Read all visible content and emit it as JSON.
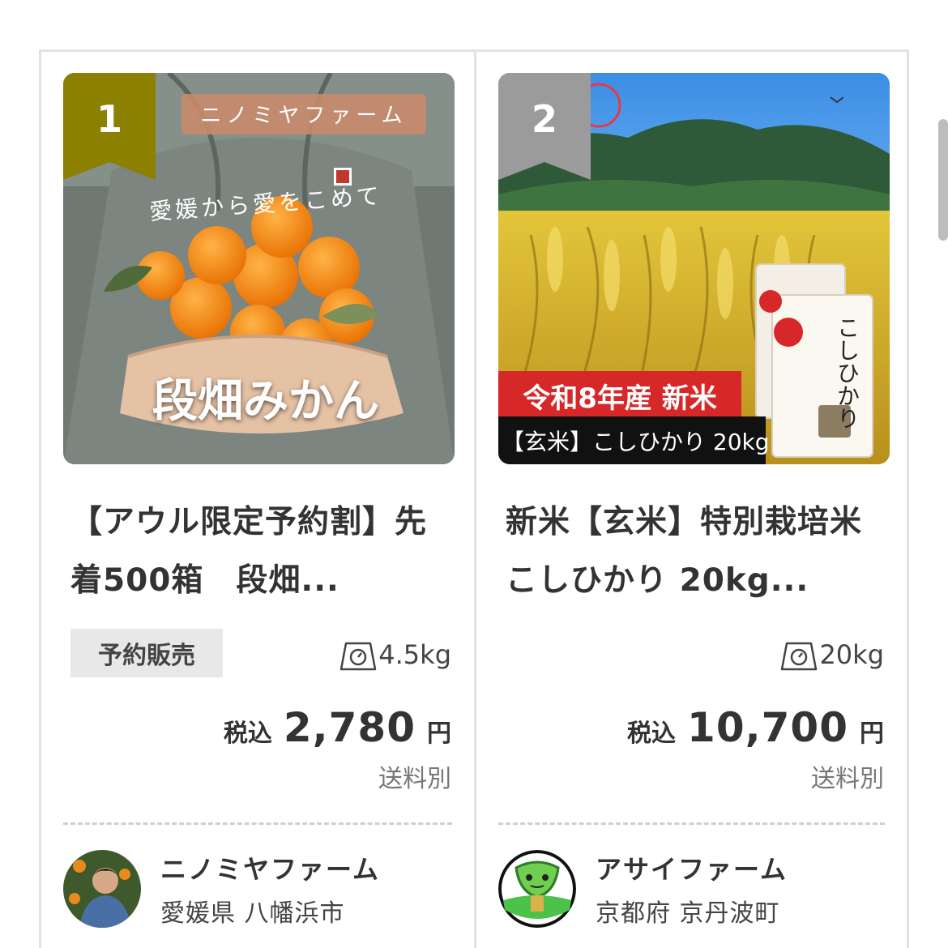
{
  "products": [
    {
      "rank": "1",
      "image_text": {
        "farm_banner": "ニノミヤファーム",
        "tagline": "愛媛から愛をこめて",
        "main_label": "段畑みかん"
      },
      "title": "【アウル限定予約割】先着500箱　段畑みかん",
      "title_display": "【アウル限定予約割】先着500箱　段畑...",
      "badge": "予約販売",
      "weight": "4.5kg",
      "tax_label": "税込",
      "price": "2,780",
      "currency": "円",
      "shipping": "送料別",
      "seller": {
        "name": "ニノミヤファーム",
        "location": "愛媛県 八幡浜市"
      }
    },
    {
      "rank": "2",
      "image_text": {
        "harvest_label": "令和8年産 新米",
        "product_label": "【玄米】こしひかり 20kg",
        "bag_label": "こしひかり"
      },
      "title": "新米【玄米】特別栽培米こしひかり 20kg",
      "title_display": "新米【玄米】特別栽培米こしひかり 20kg...",
      "weight": "20kg",
      "tax_label": "税込",
      "price": "10,700",
      "currency": "円",
      "shipping": "送料別",
      "seller": {
        "name": "アサイファーム",
        "location": "京都府 京丹波町"
      }
    }
  ],
  "colors": {
    "rank1_ribbon": "#8c8000",
    "rank2_ribbon": "#9b9b9b",
    "border": "#e2e2e2",
    "badge_bg": "#e8e8e8"
  },
  "icons": {
    "weight": "scale-icon"
  }
}
